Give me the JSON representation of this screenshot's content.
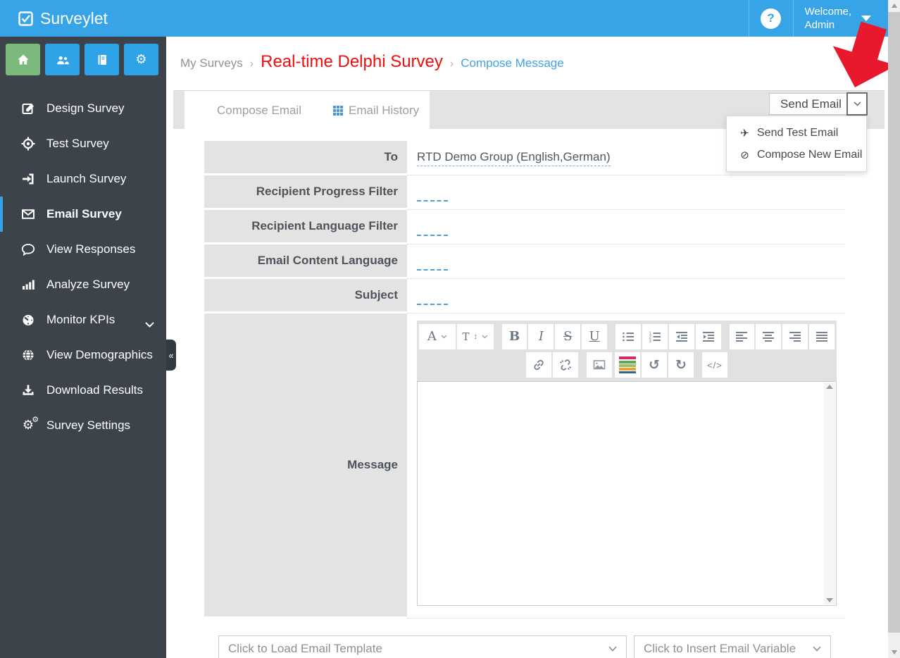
{
  "app": {
    "brand": "Surveylet",
    "help_glyph": "?",
    "welcome_line1": "Welcome,",
    "welcome_line2": "Admin"
  },
  "sidebar": {
    "quick_buttons": [
      {
        "icon": "home-icon"
      },
      {
        "icon": "users-icon"
      },
      {
        "icon": "book-icon"
      },
      {
        "icon": "gear-icon"
      }
    ],
    "items": [
      {
        "label": "Design Survey",
        "icon": "edit-icon"
      },
      {
        "label": "Test Survey",
        "icon": "target-icon"
      },
      {
        "label": "Launch Survey",
        "icon": "sign-in-icon"
      },
      {
        "label": "Email Survey",
        "icon": "envelope-icon",
        "active": true
      },
      {
        "label": "View Responses",
        "icon": "comment-icon"
      },
      {
        "label": "Analyze Survey",
        "icon": "bar-chart-icon"
      },
      {
        "label": "Monitor KPIs",
        "icon": "gauge-icon",
        "expandable": true
      },
      {
        "label": "View Demographics",
        "icon": "globe-icon"
      },
      {
        "label": "Download Results",
        "icon": "download-icon"
      },
      {
        "label": "Survey Settings",
        "icon": "gears-icon"
      }
    ],
    "collapse_glyph": "«",
    "gear_glyph": "⚙"
  },
  "breadcrumb": {
    "separator": "›",
    "items": [
      "My Surveys",
      "Real-time Delphi Survey",
      "Compose Message"
    ]
  },
  "tabs": {
    "compose": "Compose Email",
    "history": "Email History"
  },
  "actions": {
    "send_button": "Send Email",
    "menu_items": [
      {
        "label": "Send Test Email",
        "icon": "plane-icon",
        "glyph": "✈"
      },
      {
        "label": "Compose New Email",
        "icon": "ban-icon",
        "glyph": "⊘"
      }
    ]
  },
  "form": {
    "rows": [
      {
        "label": "To",
        "value": "RTD Demo Group (English,German)"
      },
      {
        "label": "Recipient Progress Filter",
        "value": ""
      },
      {
        "label": "Recipient Language Filter",
        "value": ""
      },
      {
        "label": "Email Content Language",
        "value": ""
      },
      {
        "label": "Subject",
        "value": ""
      },
      {
        "label": "Message",
        "value": ""
      }
    ]
  },
  "editor": {
    "font_glyph": "A",
    "size_glyph": "T",
    "bold": "B",
    "italic": "I",
    "strike": "S",
    "underline": "U",
    "undo_glyph": "↺",
    "redo_glyph": "↻",
    "code_glyph": "</>",
    "toolbar_row1": [
      "font-color",
      "font-size",
      "bold",
      "italic",
      "strikethrough",
      "underline",
      "unordered-list",
      "ordered-list",
      "outdent",
      "indent",
      "align-left",
      "align-center",
      "align-right",
      "align-justify"
    ],
    "toolbar_row2": [
      "link",
      "unlink",
      "image",
      "colors",
      "undo",
      "redo",
      "code-view"
    ]
  },
  "footer": {
    "template_placeholder": "Click to Load Email Template",
    "variable_placeholder": "Click to Insert Email Variable"
  },
  "colors": {
    "header_blue": "#38a4e8",
    "sidebar_dark": "#3c434b",
    "quick_green": "#7cb97c",
    "breadcrumb_red": "#f20d0d",
    "link_blue": "#41a3e4",
    "arrow_red": "#e8192c",
    "label_gray": "#e3e3e3"
  }
}
